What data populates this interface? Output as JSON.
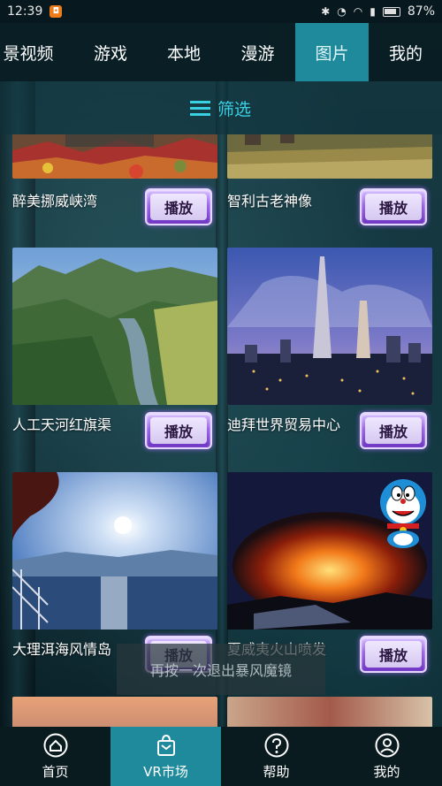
{
  "status_bar": {
    "time": "12:39",
    "battery": "87%"
  },
  "top_tabs": [
    {
      "label": "景视频",
      "active": false
    },
    {
      "label": "游戏",
      "active": false
    },
    {
      "label": "本地",
      "active": false
    },
    {
      "label": "漫游",
      "active": false
    },
    {
      "label": "图片",
      "active": true
    },
    {
      "label": "我的",
      "active": false
    }
  ],
  "filter": {
    "label": "筛选"
  },
  "cards": [
    {
      "title": "醉美挪威峡湾",
      "button": "播放",
      "thumb": "norway-fjord"
    },
    {
      "title": "智利古老神像",
      "button": "播放",
      "thumb": "chile-moai"
    },
    {
      "title": "人工天河红旗渠",
      "button": "播放",
      "thumb": "red-flag-canal"
    },
    {
      "title": "迪拜世界贸易中心",
      "button": "播放",
      "thumb": "dubai-wtc"
    },
    {
      "title": "大理洱海风情岛",
      "button": "播放",
      "thumb": "dali-erhai"
    },
    {
      "title": "夏威夷火山喷发",
      "button": "播放",
      "thumb": "hawaii-volcano"
    }
  ],
  "toast": "再按一次退出暴风魔镜",
  "bottom_nav": [
    {
      "label": "首页",
      "icon": "home-icon",
      "active": false
    },
    {
      "label": "VR市场",
      "icon": "shopping-bag-icon",
      "active": true
    },
    {
      "label": "帮助",
      "icon": "question-icon",
      "active": false
    },
    {
      "label": "我的",
      "icon": "user-icon",
      "active": false
    }
  ],
  "colors": {
    "accent": "#1f8a9b",
    "filter_text": "#39d0e3",
    "play_button": "#9b63e8"
  }
}
